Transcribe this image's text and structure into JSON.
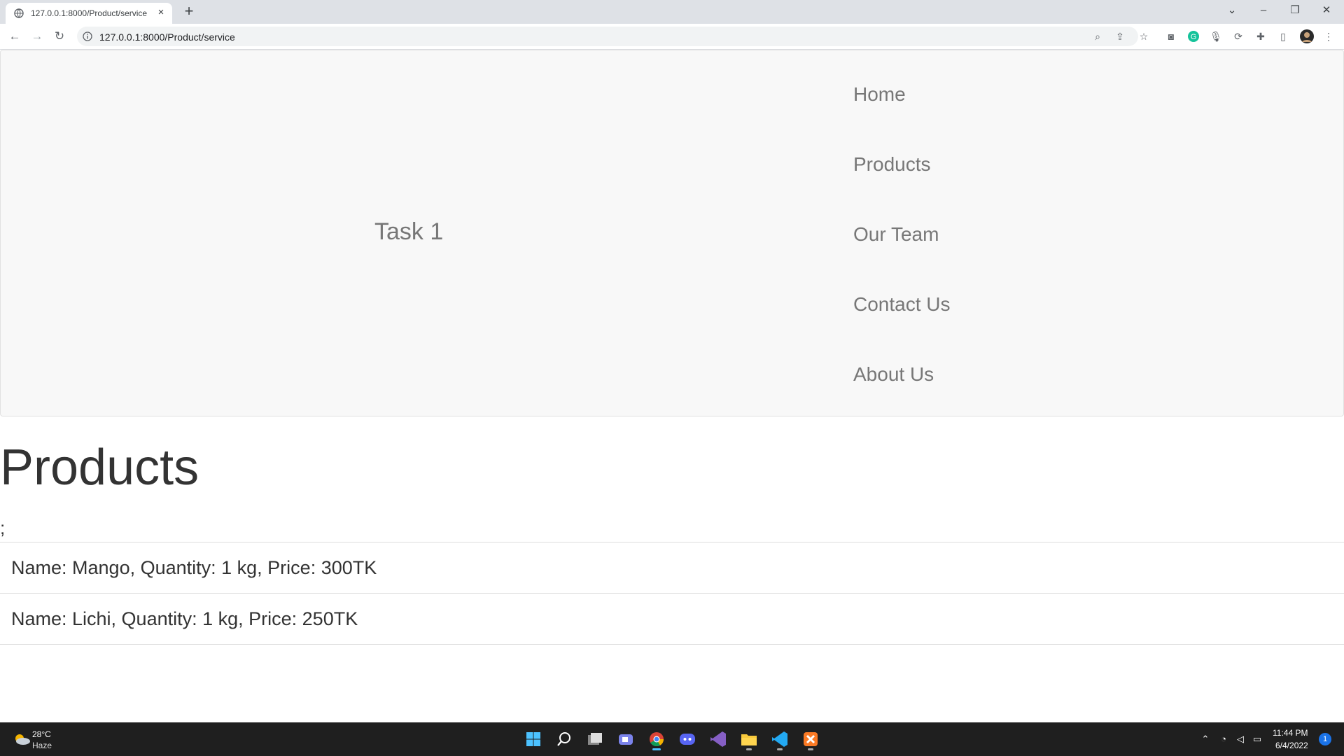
{
  "browser": {
    "tab_title": "127.0.0.1:8000/Product/service",
    "tab_close": "×",
    "new_tab": "+",
    "url": "127.0.0.1:8000/Product/service"
  },
  "site": {
    "brand": "Task 1",
    "nav": [
      "Home",
      "Products",
      "Our Team",
      "Contact Us",
      "About Us"
    ]
  },
  "main": {
    "heading": "Products",
    "stray_text": ";",
    "products": [
      "Name: Mango, Quantity: 1 kg, Price: 300TK",
      "Name: Lichi, Quantity: 1 kg, Price: 250TK"
    ]
  },
  "taskbar": {
    "temperature": "28°C",
    "condition": "Haze",
    "time": "11:44 PM",
    "date": "6/4/2022",
    "notification_count": "1"
  },
  "colors": {
    "navbar_bg": "#f8f8f8",
    "nav_text": "#777777",
    "heading_text": "#333333",
    "taskbar_bg": "#1f1f1f"
  },
  "icons": [
    "globe-icon",
    "back-icon",
    "forward-icon",
    "reload-icon",
    "info-icon",
    "zoom-icon",
    "share-icon",
    "star-icon",
    "camera-icon",
    "grammarly-icon",
    "mic-icon",
    "sync-icon",
    "extensions-icon",
    "sidepanel-icon",
    "profile-avatar",
    "menu-icon",
    "windows-start-icon",
    "search-icon",
    "task-view-icon",
    "teams-icon",
    "chrome-icon",
    "discord-icon",
    "visual-studio-icon",
    "file-explorer-icon",
    "vscode-icon",
    "xampp-icon",
    "wifi-icon",
    "volume-icon",
    "battery-icon"
  ]
}
